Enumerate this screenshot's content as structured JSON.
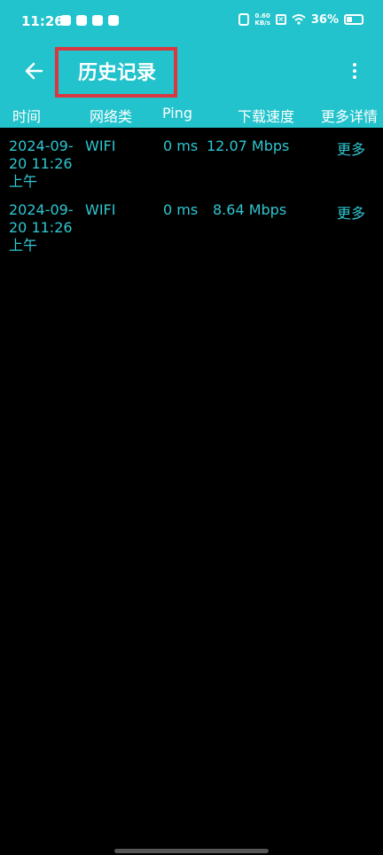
{
  "status_bar": {
    "time": "11:26",
    "net_speed_value": "0.60",
    "net_speed_unit": "KB/s",
    "battery": "36%",
    "battery_level": 0.36
  },
  "app_bar": {
    "title": "历史记录"
  },
  "table": {
    "headers": [
      "时间",
      "网络类",
      "Ping",
      "下载速度",
      "更多详情"
    ],
    "rows": [
      {
        "time": "2024-09-20 11:26上午",
        "network": "WIFI",
        "ping": "0 ms",
        "download": "12.07 Mbps",
        "more": "更多"
      },
      {
        "time": "2024-09-20 11:26上午",
        "network": "WIFI",
        "ping": "0 ms",
        "download": "8.64 Mbps",
        "more": "更多"
      }
    ]
  },
  "colors": {
    "accent": "#22c3cc",
    "row_text": "#2fc6d0",
    "highlight": "#d9373f",
    "background": "#000000"
  }
}
